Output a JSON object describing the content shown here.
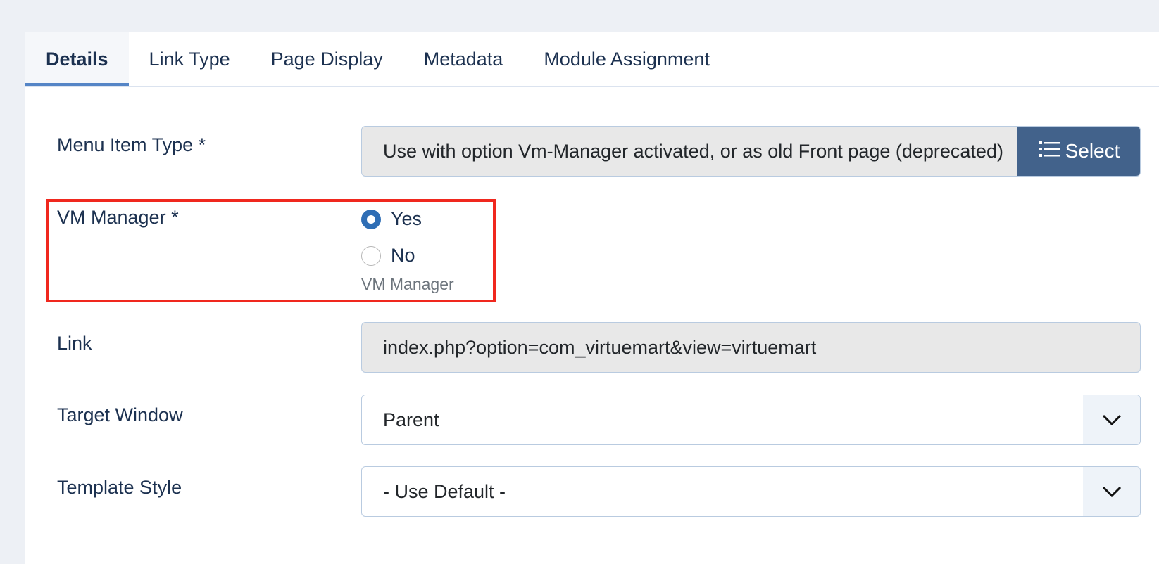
{
  "tabs": [
    {
      "label": "Details",
      "active": true
    },
    {
      "label": "Link Type",
      "active": false
    },
    {
      "label": "Page Display",
      "active": false
    },
    {
      "label": "Metadata",
      "active": false
    },
    {
      "label": "Module Assignment",
      "active": false
    }
  ],
  "form": {
    "menu_item_type": {
      "label": "Menu Item Type *",
      "value": "Use with option Vm-Manager activated, or as old Front page (deprecated)",
      "button_label": "Select",
      "button_icon": "list-icon"
    },
    "vm_manager": {
      "label": "VM Manager *",
      "options": [
        {
          "label": "Yes",
          "selected": true
        },
        {
          "label": "No",
          "selected": false
        }
      ],
      "hint": "VM Manager"
    },
    "link": {
      "label": "Link",
      "value": "index.php?option=com_virtuemart&view=virtuemart"
    },
    "target_window": {
      "label": "Target Window",
      "value": "Parent"
    },
    "template_style": {
      "label": "Template Style",
      "value": "- Use Default -"
    }
  },
  "colors": {
    "highlight": "#f0281e",
    "accent": "#2f6eb5",
    "button": "#42628b"
  }
}
